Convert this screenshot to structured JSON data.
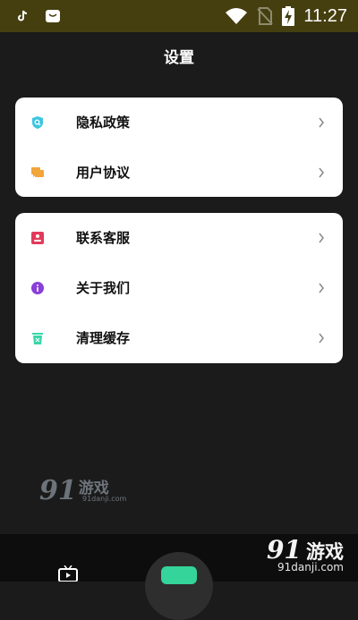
{
  "status_bar": {
    "time": "11:27",
    "icons": [
      "tiktok-icon",
      "app-notification-icon",
      "wifi-icon",
      "no-sim-icon",
      "battery-charging-icon"
    ]
  },
  "header": {
    "title": "设置"
  },
  "menu_group_1": [
    {
      "label": "隐私政策",
      "icon": "shield-search-icon",
      "icon_color": "#3bc6e0"
    },
    {
      "label": "用户协议",
      "icon": "chat-bubbles-icon",
      "icon_color": "#f2a53a"
    }
  ],
  "menu_group_2": [
    {
      "label": "联系客服",
      "icon": "contact-card-icon",
      "icon_color": "#e23b5a"
    },
    {
      "label": "关于我们",
      "icon": "info-icon",
      "icon_color": "#8a3fd8"
    },
    {
      "label": "清理缓存",
      "icon": "trash-icon",
      "icon_color": "#36d7a6"
    }
  ],
  "watermark": {
    "brand": "91",
    "game": "游戏",
    "url": "91danji.com"
  },
  "bottom_logo": {
    "brand": "91",
    "game": "游戏",
    "url": "91danji.com"
  },
  "colors": {
    "status_bar_bg": "#453f10",
    "page_bg": "#1b1b1b",
    "card_bg": "#ffffff",
    "accent_green": "#34d49a"
  }
}
